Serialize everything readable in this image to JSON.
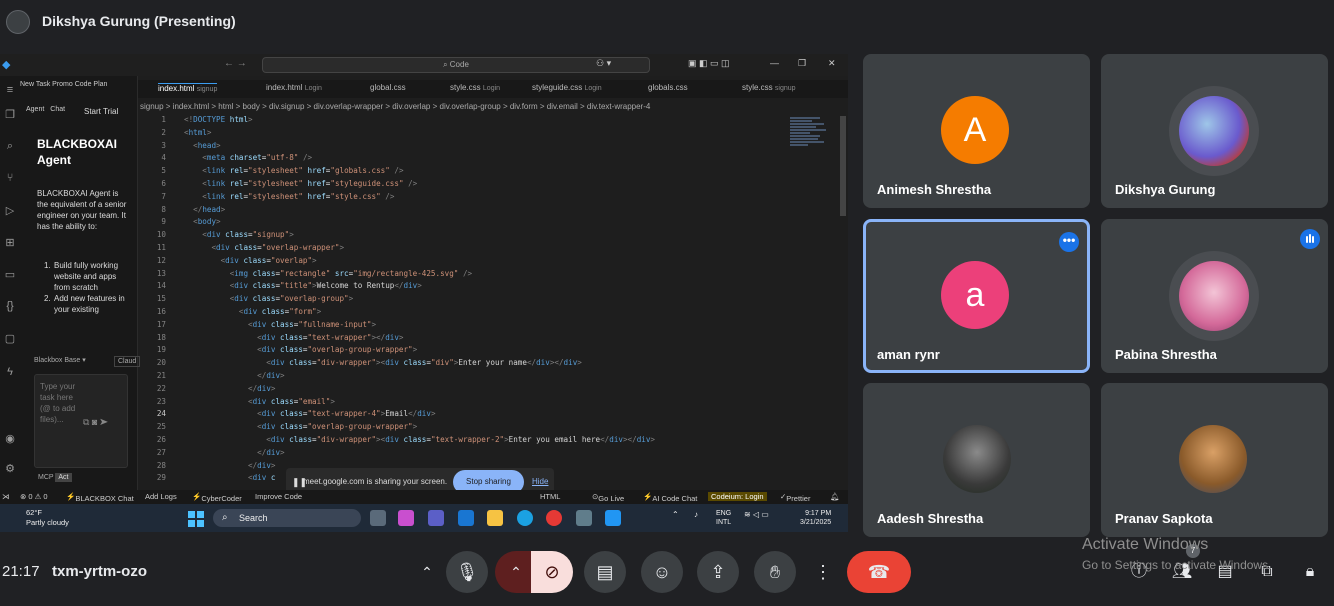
{
  "header": {
    "presenter_title": "Dikshya Gurung (Presenting)"
  },
  "vscode": {
    "search_placeholder": "Code",
    "side_tabs": "New Task  Promo Code  Plan",
    "agent_tab": "Agent",
    "chat_tab": "Chat",
    "start_trial": "Start Trial",
    "agent_title": "BLACKBOXAI Agent",
    "agent_desc": "BLACKBOXAI Agent is the equivalent of a senior engineer on your team. It has the ability to:",
    "list": [
      {
        "n": "1.",
        "text": "Build fully working website and apps from scratch"
      },
      {
        "n": "2.",
        "text": "Add new features in your existing"
      }
    ],
    "model_select": "Blackbox Base",
    "model_select2": "Claud",
    "input_placeholder": "Type your task here (@ to add files)...",
    "mcp": "MCP",
    "act": "Act",
    "tabs": [
      {
        "label": "index.html",
        "sub": "signup",
        "active": true
      },
      {
        "label": "index.html",
        "sub": "Login"
      },
      {
        "label": "global.css",
        "sub": ""
      },
      {
        "label": "style.css",
        "sub": "Login"
      },
      {
        "label": "styleguide.css",
        "sub": "Login"
      },
      {
        "label": "globals.css",
        "sub": ""
      },
      {
        "label": "style.css",
        "sub": "signup"
      }
    ],
    "breadcrumb": "signup  >  index.html  >  html  >  body  >  div.signup  >  div.overlap-wrapper  >  div.overlap  >  div.overlap-group  >  div.form  >  div.email  >  div.text-wrapper-4",
    "share_notice": {
      "message": "meet.google.com is sharing your screen.",
      "stop": "Stop sharing",
      "hide": "Hide"
    },
    "status": {
      "errors": "⊗ 0 ⚠ 0",
      "blackbox": "BLACKBOX Chat",
      "addlogs": "Add Logs",
      "cybercoder": "CyberCoder",
      "improve": "Improve Code",
      "html": "HTML",
      "golive": "Go Live",
      "aicode": "AI Code Chat",
      "codeium": "Codeium: Login",
      "prettier": "Prettier"
    },
    "taskbar": {
      "temp": "62°F",
      "weather": "Partly cloudy",
      "search": "Search",
      "lang1": "ENG",
      "lang2": "INTL",
      "time": "9:17 PM",
      "date": "3/21/2025"
    }
  },
  "participants": [
    {
      "name": "Animesh Shrestha",
      "initial": "A",
      "color": "#f57c00"
    },
    {
      "name": "Dikshya Gurung"
    },
    {
      "name": "aman rynr",
      "initial": "a",
      "color": "#ec407a"
    },
    {
      "name": "Pabina Shrestha"
    },
    {
      "name": "Aadesh Shrestha"
    },
    {
      "name": "Pranav Sapkota"
    }
  ],
  "bottom": {
    "time": "21:17",
    "code": "txm-yrtm-ozo",
    "badge": "7"
  },
  "watermark": {
    "line1": "Activate Windows",
    "line2": "Go to Settings to activate Windows."
  }
}
